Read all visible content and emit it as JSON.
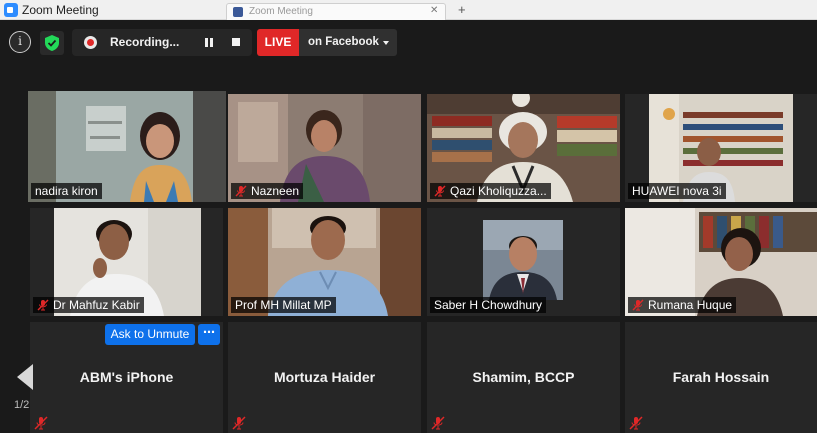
{
  "window": {
    "title": "Zoom Meeting",
    "background_tab": "Zoom Meeting"
  },
  "toolbar": {
    "info_icon": "i",
    "recording_label": "Recording...",
    "live_badge": "LIVE",
    "live_destination": "on Facebook"
  },
  "participants": [
    {
      "name": "nadira kiron",
      "muted": false,
      "video": true,
      "active_speaker": true
    },
    {
      "name": "Nazneen",
      "muted": true,
      "video": true
    },
    {
      "name": "Qazi Kholiquzza...",
      "muted": true,
      "video": true
    },
    {
      "name": "HUAWEI nova 3i",
      "muted": true,
      "video": true
    },
    {
      "name": "Dr Mahfuz Kabir",
      "muted": true,
      "video": true
    },
    {
      "name": "Prof MH Millat MP",
      "muted": false,
      "video": true
    },
    {
      "name": "Saber H Chowdhury",
      "muted": false,
      "video": true
    },
    {
      "name": "Rumana Huque",
      "muted": true,
      "video": true
    },
    {
      "name": "ABM's iPhone",
      "muted": true,
      "video": false
    },
    {
      "name": "Mortuza Haider",
      "muted": true,
      "video": false
    },
    {
      "name": "Shamim, BCCP",
      "muted": true,
      "video": false
    },
    {
      "name": "Farah Hossain",
      "muted": true,
      "video": false
    }
  ],
  "hover_actions": {
    "ask_to_unmute": "Ask to Unmute",
    "more": "⋯"
  },
  "pagination": {
    "label": "1/2"
  },
  "colors": {
    "live_red": "#e02828",
    "active_speaker_outline": "#d6ea6e",
    "action_blue": "#0e71eb",
    "mute_red": "#e02828",
    "shield_green": "#23d959"
  }
}
